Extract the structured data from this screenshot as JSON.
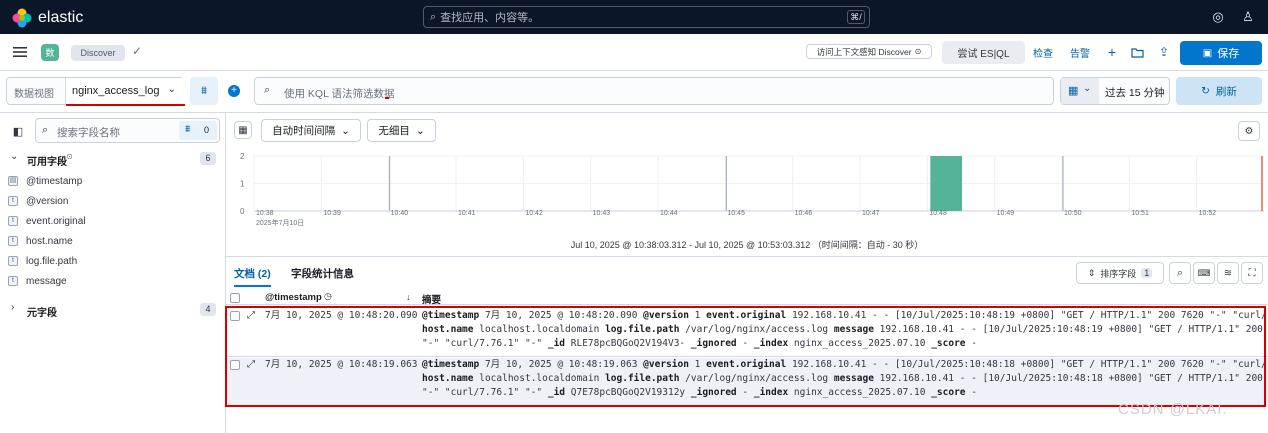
{
  "topbar": {
    "brand": "elastic",
    "search_placeholder": "查找应用、内容等。",
    "shortcut": "⌘/"
  },
  "appbar": {
    "badge": "数",
    "breadcrumb": "Discover",
    "inspect_label": "访问上下文感知 Discover",
    "esql_label": "尝试 ES|QL",
    "inspect_btn": "检查",
    "alerts_btn": "告警",
    "save_label": "保存"
  },
  "querybar": {
    "dataview_label": "数据视图",
    "dataview_value": "nginx_access_log",
    "kql_placeholder": "使用 KQL 语法筛选数据",
    "time_label": "过去 15 分钟",
    "refresh_label": "刷新"
  },
  "sidebar": {
    "search_placeholder": "搜索字段名称",
    "filter_count": "0",
    "available_label": "可用字段",
    "available_count": "6",
    "fields": [
      {
        "icon": "calendar-icon",
        "name": "@timestamp"
      },
      {
        "icon": "text-icon",
        "name": "@version"
      },
      {
        "icon": "text-icon",
        "name": "event.original"
      },
      {
        "icon": "text-icon",
        "name": "host.name"
      },
      {
        "icon": "text-icon",
        "name": "log.file.path"
      },
      {
        "icon": "text-icon",
        "name": "message"
      }
    ],
    "meta_label": "元字段",
    "meta_count": "4"
  },
  "histogram": {
    "auto_interval": "自动时间间隔",
    "breakdown": "无细目",
    "y_ticks": [
      "2",
      "1",
      "0"
    ],
    "x_ticks": [
      "10:38",
      "10:39",
      "10:40",
      "10:41",
      "10:42",
      "10:43",
      "10:44",
      "10:45",
      "10:46",
      "10:47",
      "10:48",
      "10:49",
      "10:50",
      "10:51",
      "10:52"
    ],
    "x_date": "2025年7月10日",
    "range_caption": "Jul 10, 2025 @ 10:38:03.312 - Jul 10, 2025 @ 10:53:03.312 （时间间隔：自动 - 30 秒）"
  },
  "chart_data": {
    "type": "bar",
    "categories": [
      "10:48"
    ],
    "values": [
      2
    ],
    "ylim": [
      0,
      2
    ]
  },
  "docs": {
    "tab_docs": "文档 (2)",
    "tab_stats": "字段统计信息",
    "sort_label": "排序字段",
    "sort_count": "1",
    "col_timestamp": "@timestamp",
    "col_summary": "摘要",
    "rows": [
      {
        "time": "7月 10, 2025 @ 10:48:20.090",
        "ts": "7月 10, 2025 @ 10:48:20.090",
        "version": "1",
        "event_original": "192.168.10.41 - - [10/Jul/2025:10:48:19 +0800] \"GET / HTTP/1.1\" 200 7620 \"-\" \"curl/7.76.1\" \"-\"",
        "host": "localhost.localdomain",
        "path": "/var/log/nginx/access.log",
        "message1": "192.168.10.41 - - [10/Jul/2025:10:48:19 +0800] \"GET / HTTP/1.1\" 200 7620",
        "message2": "\"-\" \"curl/7.76.1\" \"-\"",
        "id": "RLE78pcBQGoQ2V194V3-",
        "ignored": "-",
        "index": "nginx_access_2025.07.10",
        "score": "-"
      },
      {
        "time": "7月 10, 2025 @ 10:48:19.063",
        "ts": "7月 10, 2025 @ 10:48:19.063",
        "version": "1",
        "event_original": "192.168.10.41 - - [10/Jul/2025:10:48:18 +0800] \"GET / HTTP/1.1\" 200 7620 \"-\" \"curl/7.76.1\" \"-\"",
        "host": "localhost.localdomain",
        "path": "/var/log/nginx/access.log",
        "message1": "192.168.10.41 - - [10/Jul/2025:10:48:18 +0800] \"GET / HTTP/1.1\" 200 7620",
        "message2": "\"-\" \"curl/7.76.1\" \"-\"",
        "id": "Q7E78pcBQGoQ2V19312y",
        "ignored": "-",
        "index": "nginx_access_2025.07.10",
        "score": "-"
      }
    ]
  },
  "watermark": "CSDN @LKAI."
}
